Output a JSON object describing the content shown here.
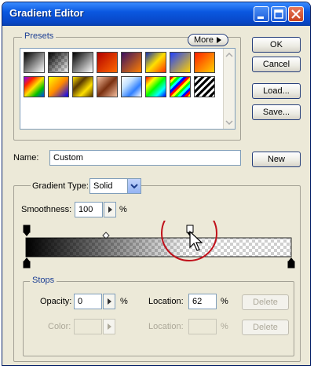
{
  "window": {
    "title": "Gradient Editor"
  },
  "presets": {
    "legend": "Presets",
    "more_label": "More"
  },
  "buttons": {
    "ok": "OK",
    "cancel": "Cancel",
    "load": "Load...",
    "save": "Save...",
    "new": "New"
  },
  "name": {
    "label": "Name:",
    "value": "Custom"
  },
  "gradient": {
    "type_label": "Gradient Type:",
    "type_value": "Solid",
    "smoothness_label": "Smoothness:",
    "smoothness_value": "100",
    "smoothness_unit": "%"
  },
  "stops": {
    "legend": "Stops",
    "opacity_label": "Opacity:",
    "opacity_value": "0",
    "opacity_unit": "%",
    "location_label": "Location:",
    "location_value": "62",
    "location_unit": "%",
    "delete_label": "Delete",
    "color_label": "Color:",
    "color_location_label": "Location:",
    "color_location_unit": "%",
    "color_delete_label": "Delete"
  },
  "colors": {
    "accent": "#0a58e0",
    "highlight_circle": "#c0101a"
  }
}
